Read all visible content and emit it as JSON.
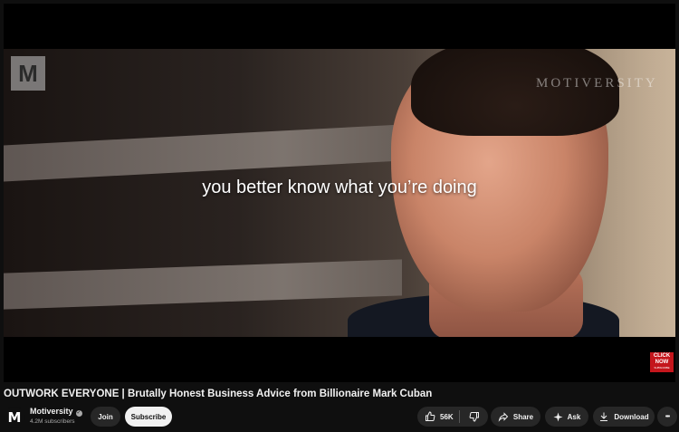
{
  "video": {
    "caption": "you better know what you’re doing",
    "watermark": "MOTIVERSITY",
    "logo_letter": "M",
    "click_now_label": "CLICK NOW",
    "click_now_sublabel": "SUBSCRIBE"
  },
  "title": "OUTWORK EVERYONE | Brutally Honest Business Advice from Billionaire Mark Cuban",
  "channel": {
    "avatar_letter": "M",
    "name": "Motiversity",
    "subscribers": "4.2M subscribers",
    "join_label": "Join",
    "subscribe_label": "Subscribe"
  },
  "actions": {
    "like_count": "56K",
    "share_label": "Share",
    "ask_label": "Ask",
    "download_label": "Download",
    "more_label": "•••"
  },
  "icons": [
    "thumbs-up-icon",
    "thumbs-down-icon",
    "share-icon",
    "sparkle-icon",
    "download-icon",
    "more-icon",
    "verified-icon"
  ]
}
